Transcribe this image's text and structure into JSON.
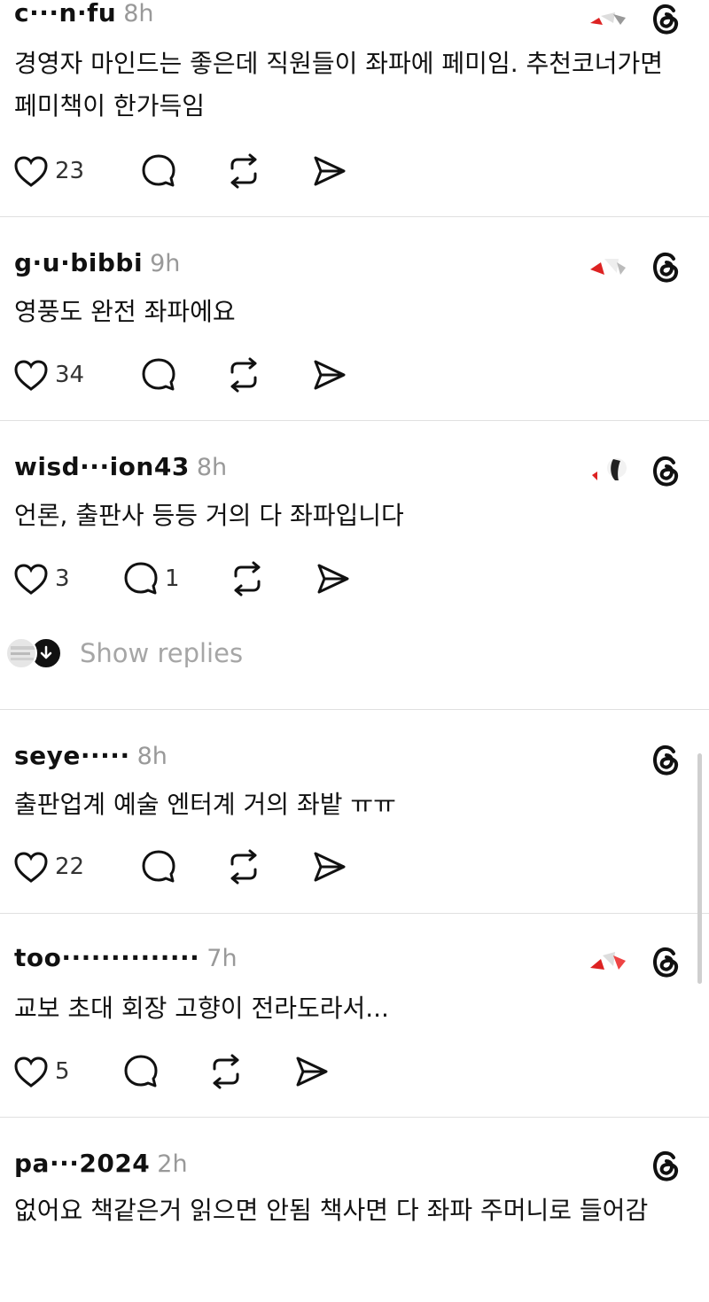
{
  "posts": [
    {
      "username": "c···n·fu",
      "time": "8h",
      "text": "경영자 마인드는 좋은데 직원들이 좌파에 페미임. 추천코너가면 페미책이 한가득임",
      "likes": "23",
      "comments": "",
      "has_avatar": true
    },
    {
      "username": "g·u·bibbi",
      "time": "9h",
      "text": "영풍도 완전 좌파에요",
      "likes": "34",
      "comments": "",
      "has_avatar": true
    },
    {
      "username": "wisd···ion43",
      "time": "8h",
      "text": "언론, 출판사 등등 거의 다 좌파입니다",
      "likes": "3",
      "comments": "1",
      "has_avatar": true
    },
    {
      "username": "seye·····",
      "time": "8h",
      "text": "출판업계 예술 엔터계 거의 좌밭 ㅠㅠ",
      "likes": "22",
      "comments": "",
      "has_avatar": false
    },
    {
      "username": "too··············",
      "time": "7h",
      "text": "교보 초대 회장 고향이 전라도라서...",
      "likes": "5",
      "comments": "",
      "has_avatar": true
    },
    {
      "username": "pa···2024",
      "time": "2h",
      "text": "없어요 책같은거 읽으면 안됨 책사면 다 좌파 주머니로 들어감",
      "likes": "",
      "comments": "",
      "has_avatar": false
    }
  ],
  "show_replies": {
    "label": "Show replies"
  },
  "icons": {
    "like": "heart-icon",
    "comment": "comment-bubble-icon",
    "repost": "repost-icon",
    "share": "send-icon",
    "brand": "threads-logo-icon"
  }
}
